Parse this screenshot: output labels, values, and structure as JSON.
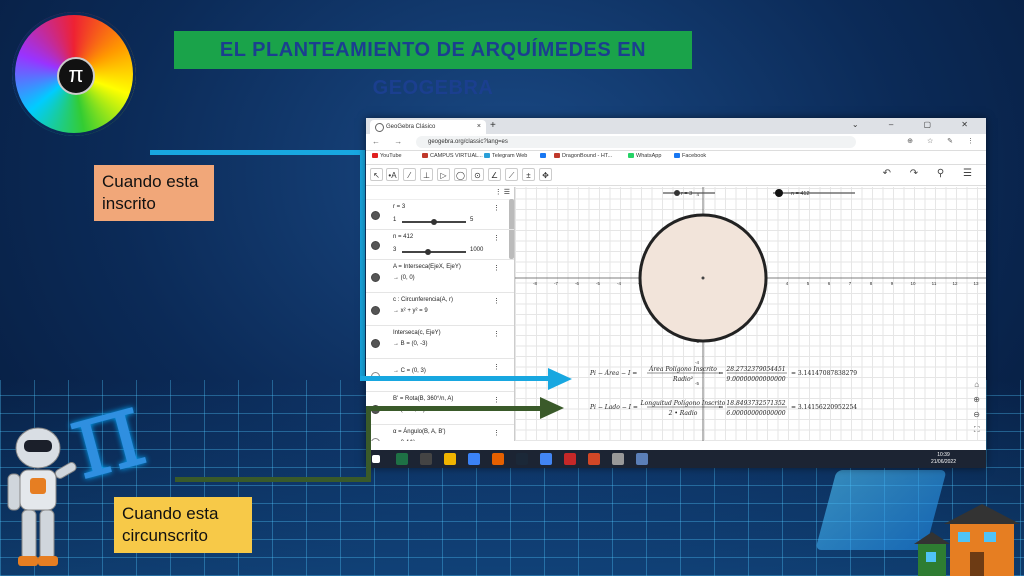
{
  "slide": {
    "title": "EL PLANTEAMIENTO DE ARQUÍMEDES EN GEOGEBRA",
    "label_inscribed": "Cuando esta inscrito",
    "label_circumscribed": "Cuando esta circunscrito",
    "logo_symbol": "π",
    "colors": {
      "title_bg": "#1aa34a",
      "title_text": "#1b3f8f",
      "blue_arrow": "#18a7e0",
      "green_arrow": "#3a5a2a"
    }
  },
  "browser": {
    "tab_title": "GeoGebra Clásico",
    "tab_close": "×",
    "new_tab": "+",
    "url": "geogebra.org/classic?lang=es",
    "nav_icons": "← → ⟳",
    "addr_icons": "⊕ ☆ ✎ ⋮",
    "window_controls": "⌄ – ▢ ✕",
    "bookmarks": [
      {
        "label": "YouTube",
        "color": "#e02020"
      },
      {
        "label": "CAMPUS VIRTUAL...",
        "color": "#c0392b"
      },
      {
        "label": "Telegram Web",
        "color": "#2a9fd8"
      },
      {
        "label": "",
        "color": "#1877f2"
      },
      {
        "label": "DragonBound - HT...",
        "color": "#c0392b"
      },
      {
        "label": "WhatsApp",
        "color": "#25d366"
      },
      {
        "label": "Facebook",
        "color": "#1877f2"
      }
    ]
  },
  "geogebra": {
    "toolbar_right": "↶ ↷ ⚲ ☰",
    "top_slider_right_label": "n = 412",
    "top_slider_left_label": "r = 3",
    "algebra": [
      {
        "label": "r = 3",
        "slider_min": "1",
        "slider_max": "5",
        "slider_value": 3
      },
      {
        "label": "n = 412",
        "slider_min": "3",
        "slider_max": "1000",
        "slider_value": 412
      },
      {
        "label": "A = Interseca(EjeX, EjeY)",
        "sub": "→ (0, 0)"
      },
      {
        "label": "c : Circunferencia(A, r)",
        "sub": "→ x² + y² = 9"
      },
      {
        "label": "Interseca(c, EjeY)",
        "sub": "→ B = (0, -3)"
      },
      {
        "label": "",
        "sub": "→ C = (0, 3)"
      },
      {
        "label": "B' = Rota(B, 360°/n, A)",
        "sub": "→ (0.02, -3)"
      },
      {
        "label": "α = Ángulo(B, A, B')",
        "sub": "→ 0.44°"
      }
    ],
    "x_ticks": [
      "-8",
      "-7",
      "-6",
      "-5",
      "-4",
      "-3",
      "-2",
      "-1",
      "0",
      "1",
      "2",
      "3",
      "4",
      "5",
      "6",
      "7",
      "8",
      "9",
      "10",
      "11",
      "12",
      "13"
    ],
    "y_ticks": [
      "4",
      "3",
      "2",
      "1",
      "-1",
      "-2",
      "-3",
      "-4",
      "-5"
    ],
    "formula1": {
      "lhs": "Pi − Área − I =",
      "num": "Área Polígono Inscrito",
      "den": "Radio²",
      "eq": "=",
      "num2": "28.2732379054451",
      "den2": "9.00000000000000",
      "result": "= 3.14147087838279"
    },
    "formula2": {
      "lhs": "Pi − Lado − I =",
      "num": "Longuitud Polígono Inscrito",
      "den": "2 • Radio",
      "eq": "=",
      "num2": "18.8493732571352",
      "den2": "6.00000000000000",
      "result": "= 3.14156220952254"
    },
    "circle_radius": 3,
    "circle_fill": "#f2e4da"
  },
  "taskbar": {
    "time": "10:39",
    "date": "21/06/2022",
    "apps": [
      "#1e7145",
      "#444",
      "#f0b400",
      "#3b82f6",
      "#e66000",
      "#1b2838",
      "#4285f4",
      "#c62828",
      "#d24726",
      "#999",
      "#5b7fb8"
    ]
  }
}
